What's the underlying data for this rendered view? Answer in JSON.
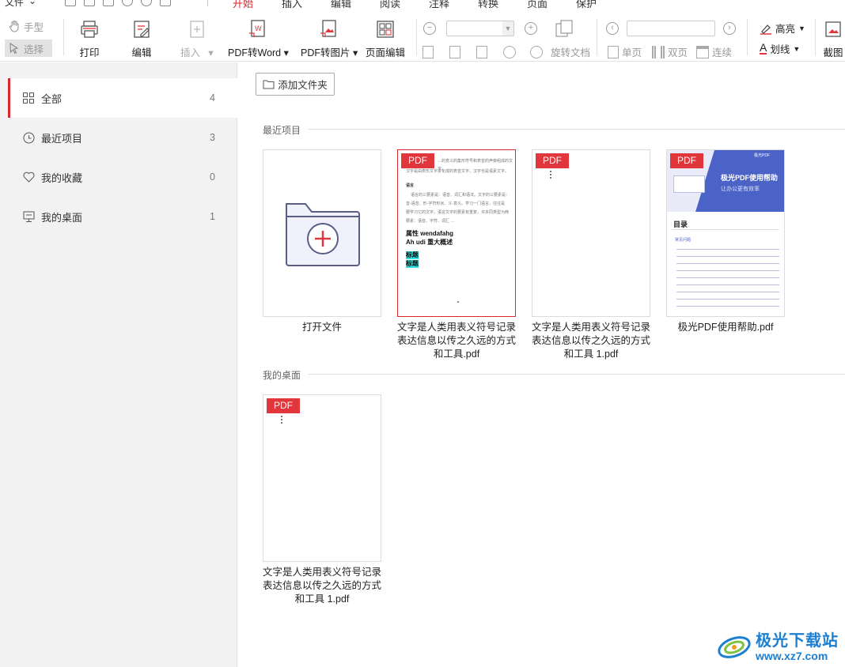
{
  "menubar": {
    "file_label": "文件",
    "tabs": [
      {
        "label": "开始",
        "active": true
      },
      {
        "label": "插入",
        "active": false
      },
      {
        "label": "编辑",
        "active": false
      },
      {
        "label": "阅读",
        "active": false
      },
      {
        "label": "注释",
        "active": false
      },
      {
        "label": "转换",
        "active": false
      },
      {
        "label": "页面",
        "active": false
      },
      {
        "label": "保护",
        "active": false
      }
    ]
  },
  "toolbar": {
    "hand_label": "手型",
    "select_label": "选择",
    "print_label": "打印",
    "edit_label": "编辑",
    "insert_label": "插入",
    "pdf2word_label": "PDF转Word",
    "pdf2img_label": "PDF转图片",
    "page_edit_label": "页面编辑",
    "rotate_doc_label": "旋转文档",
    "single_label": "单页",
    "double_label": "双页",
    "continuous_label": "连续",
    "highlight_label": "高亮",
    "underline_label": "划线",
    "screenshot_label": "截图",
    "zoom_value": "",
    "page_value": ""
  },
  "sidebar": {
    "items": [
      {
        "label": "全部",
        "count": "4",
        "icon": "grid-icon",
        "active": true
      },
      {
        "label": "最近项目",
        "count": "3",
        "icon": "clock-icon",
        "active": false
      },
      {
        "label": "我的收藏",
        "count": "0",
        "icon": "heart-icon",
        "active": false
      },
      {
        "label": "我的桌面",
        "count": "1",
        "icon": "desktop-icon",
        "active": false
      }
    ]
  },
  "main": {
    "add_folder_label": "添加文件夹",
    "recent_title": "最近项目",
    "desktop_title": "我的桌面",
    "pdf_badge": "PDF",
    "open_file_label": "打开文件",
    "recent_files": [
      {
        "name": "文字是人类用表义符号记录表达信息以传之久远的方式和工具.pdf",
        "line1": "文字是人类用表义符号记录",
        "line2": "表达信息以传之久远的方式",
        "line3": "和工具.pdf"
      },
      {
        "name": "文字是人类用表义符号记录表达信息以传之久远的方式和工具 1.pdf",
        "line1": "文字是人类用表义符号记录",
        "line2": "表达信息以传之久远的方式",
        "line3": "和工具 1.pdf"
      },
      {
        "name": "极光PDF使用帮助.pdf",
        "line1": "极光PDF使用帮助.pdf"
      }
    ],
    "desktop_files": [
      {
        "name": "文字是人类用表义符号记录表达信息以传之久远的方式和工具 1.pdf",
        "line1": "文字是人类用表义符号记录",
        "line2": "表达信息以传之久远的方式",
        "line3": "和工具 1.pdf"
      }
    ],
    "thumb1": {
      "p1": "…的意义的集形符号和表音的声旁组成的文字。",
      "p2": "汉字是由表形文字进化成的表音文字，汉字也是语素文字。",
      "h1": "语言",
      "p3": "语言的三要素是：语音、词汇和语法。文字的三要素是：",
      "p4": "音-语音、形-字符形状、义-意义。学习一门语言，往往是",
      "p5": "要学习它的文字。语言文字的要素有重复，许多同类型为两",
      "p6": "要素：语音、字符、词汇 …",
      "b1": "属性 wendafahg",
      "b2": "Ah udi 重大概述",
      "c1": "标题",
      "c2": "标题"
    },
    "help_thumb": {
      "brand": "极光PDF",
      "title": "极光PDF使用帮助",
      "subtitle": "让办公更有效率",
      "toc": "目录",
      "toc_sub": "常见问题"
    }
  },
  "watermark": {
    "text": "极光下载站",
    "url": "www.xz7.com"
  },
  "colors": {
    "accent": "#d9272e",
    "pdf_badge": "#e1363c",
    "help_banner": "#4b63c7",
    "watermark": "#1d7fd1"
  }
}
